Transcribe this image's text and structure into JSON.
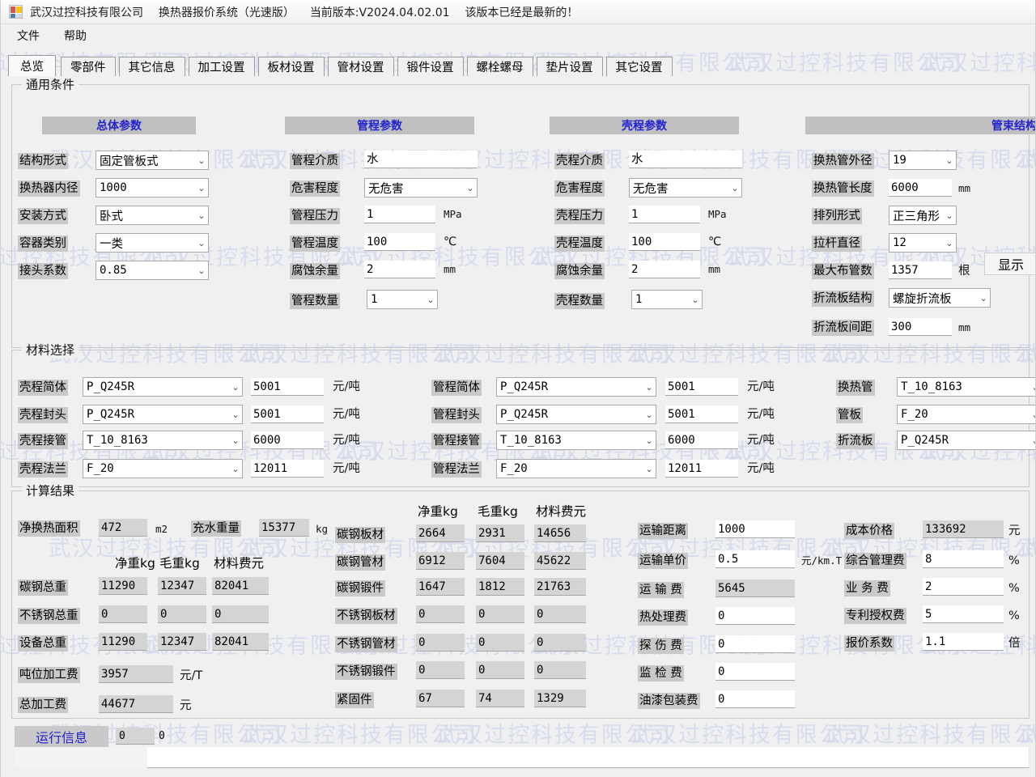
{
  "window": {
    "icon": "app-icon",
    "company": "武汉过控科技有限公司",
    "product": "换热器报价系统（光速版）",
    "version_label": "当前版本:V2024.04.02.01",
    "update_note": "该版本已经是最新的！"
  },
  "menu": [
    {
      "label": "文件"
    },
    {
      "label": "帮助"
    }
  ],
  "tabs": [
    {
      "label": "总览",
      "active": true
    },
    {
      "label": "零部件",
      "active": false
    },
    {
      "label": "其它信息",
      "active": false
    },
    {
      "label": "加工设置",
      "active": false
    },
    {
      "label": "板材设置",
      "active": false
    },
    {
      "label": "管材设置",
      "active": false
    },
    {
      "label": "锻件设置",
      "active": false
    },
    {
      "label": "螺栓螺母",
      "active": false
    },
    {
      "label": "垫片设置",
      "active": false
    },
    {
      "label": "其它设置",
      "active": false
    }
  ],
  "watermark": {
    "text": "武汉过控科技有限公司",
    "color": "#d7dced"
  },
  "general": {
    "title": "通用条件",
    "overall": {
      "header": "总体参数",
      "fields": [
        {
          "label": "结构形式",
          "value": "固定管板式",
          "type": "combo"
        },
        {
          "label": "换热器内径",
          "value": "1000",
          "type": "combo"
        },
        {
          "label": "安装方式",
          "value": "卧式",
          "type": "combo"
        },
        {
          "label": "容器类别",
          "value": "一类",
          "type": "combo"
        },
        {
          "label": "接头系数",
          "value": "0.85",
          "type": "combo"
        }
      ]
    },
    "tube_side": {
      "header": "管程参数",
      "fields": [
        {
          "label": "管程介质",
          "value": "水",
          "type": "text",
          "unit": ""
        },
        {
          "label": "危害程度",
          "value": "无危害",
          "type": "combo",
          "unit": ""
        },
        {
          "label": "管程压力",
          "value": "1",
          "type": "text",
          "unit": "MPa"
        },
        {
          "label": "管程温度",
          "value": "100",
          "type": "text",
          "unit": "℃"
        },
        {
          "label": "腐蚀余量",
          "value": "2",
          "type": "text",
          "unit": "mm"
        },
        {
          "label": "管程数量",
          "value": "1",
          "type": "combo",
          "unit": ""
        }
      ]
    },
    "shell_side": {
      "header": "壳程参数",
      "fields": [
        {
          "label": "壳程介质",
          "value": "水",
          "type": "text",
          "unit": ""
        },
        {
          "label": "危害程度",
          "value": "无危害",
          "type": "combo",
          "unit": ""
        },
        {
          "label": "壳程压力",
          "value": "1",
          "type": "text",
          "unit": "MPa"
        },
        {
          "label": "壳程温度",
          "value": "100",
          "type": "text",
          "unit": "℃"
        },
        {
          "label": "腐蚀余量",
          "value": "2",
          "type": "text",
          "unit": "mm"
        },
        {
          "label": "壳程数量",
          "value": "1",
          "type": "combo",
          "unit": ""
        }
      ]
    },
    "bundle": {
      "header": "管束结构",
      "display_button": "显示",
      "fields": [
        {
          "label": "换热管外径",
          "value": "19",
          "type": "combo",
          "unit": ""
        },
        {
          "label": "换热管长度",
          "value": "6000",
          "type": "text",
          "unit": "mm"
        },
        {
          "label": "排列形式",
          "value": "正三角形",
          "type": "combo",
          "unit": ""
        },
        {
          "label": "拉杆直径",
          "value": "12",
          "type": "combo",
          "unit": ""
        },
        {
          "label": "最大布管数",
          "value": "1357",
          "type": "text",
          "unit": "根"
        },
        {
          "label": "折流板结构",
          "value": "螺旋折流板",
          "type": "combo",
          "unit": ""
        },
        {
          "label": "折流板间距",
          "value": "300",
          "type": "text",
          "unit": "mm"
        }
      ]
    }
  },
  "materials": {
    "title": "材料选择",
    "unit": "元/吨",
    "shell": [
      {
        "label": "壳程简体",
        "material": "P_Q245R",
        "price": "5001"
      },
      {
        "label": "壳程封头",
        "material": "P_Q245R",
        "price": "5001"
      },
      {
        "label": "壳程接管",
        "material": "T_10_8163",
        "price": "6000"
      },
      {
        "label": "壳程法兰",
        "material": "F_20",
        "price": "12011"
      }
    ],
    "tube": [
      {
        "label": "管程简体",
        "material": "P_Q245R",
        "price": "5001"
      },
      {
        "label": "管程封头",
        "material": "P_Q245R",
        "price": "5001"
      },
      {
        "label": "管程接管",
        "material": "T_10_8163",
        "price": "6000"
      },
      {
        "label": "管程法兰",
        "material": "F_20",
        "price": "12011"
      }
    ],
    "bundle": [
      {
        "label": "换热管",
        "material": "T_10_8163"
      },
      {
        "label": "管板",
        "material": "F_20"
      },
      {
        "label": "折流板",
        "material": "P_Q245R"
      }
    ]
  },
  "results": {
    "title": "计算结果",
    "top": [
      {
        "label": "净换热面积",
        "value": "472",
        "unit": "m2"
      },
      {
        "label": "充水重量",
        "value": "15377",
        "unit": "kg"
      }
    ],
    "col_headers": [
      "净重kg",
      "毛重kg",
      "材料费元"
    ],
    "left_rows": [
      {
        "label": "碳钢总重",
        "net": "11290",
        "gross": "12347",
        "cost": "82041"
      },
      {
        "label": "不锈钢总重",
        "net": "0",
        "gross": "0",
        "cost": "0"
      },
      {
        "label": "设备总重",
        "net": "11290",
        "gross": "12347",
        "cost": "82041"
      }
    ],
    "left_extra": [
      {
        "label": "吨位加工费",
        "value": "3957",
        "unit": "元/T"
      },
      {
        "label": "总加工费",
        "value": "44677",
        "unit": "元"
      }
    ],
    "mid_rows": [
      {
        "label": "碳钢板材",
        "net": "2664",
        "gross": "2931",
        "cost": "14656"
      },
      {
        "label": "碳钢管材",
        "net": "6912",
        "gross": "7604",
        "cost": "45622"
      },
      {
        "label": "碳钢锻件",
        "net": "1647",
        "gross": "1812",
        "cost": "21763"
      },
      {
        "label": "不锈钢板材",
        "net": "0",
        "gross": "0",
        "cost": "0"
      },
      {
        "label": "不锈钢管材",
        "net": "0",
        "gross": "0",
        "cost": "0"
      },
      {
        "label": "不锈钢锻件",
        "net": "0",
        "gross": "0",
        "cost": "0"
      },
      {
        "label": "紧固件",
        "net": "67",
        "gross": "74",
        "cost": "1329"
      }
    ],
    "fees": [
      {
        "label": "运输距离",
        "value": "1000",
        "unit": "",
        "readonly": false
      },
      {
        "label": "运输单价",
        "value": "0.5",
        "unit": "元/km.T",
        "readonly": false
      },
      {
        "label": "运 输 费",
        "value": "5645",
        "unit": "",
        "readonly": true
      },
      {
        "label": "热处理费",
        "value": "0",
        "unit": "",
        "readonly": false
      },
      {
        "label": "探 伤 费",
        "value": "0",
        "unit": "",
        "readonly": false
      },
      {
        "label": "监 检 费",
        "value": "0",
        "unit": "",
        "readonly": false
      },
      {
        "label": "油漆包装费",
        "value": "0",
        "unit": "",
        "readonly": false
      }
    ],
    "pricing": [
      {
        "label": "成本价格",
        "value": "133692",
        "unit": "元",
        "readonly": true
      },
      {
        "label": "综合管理费",
        "value": "8",
        "unit": "%",
        "readonly": false
      },
      {
        "label": "业 务 费",
        "value": "2",
        "unit": "%",
        "readonly": false
      },
      {
        "label": "专利授权费",
        "value": "5",
        "unit": "%",
        "readonly": false
      },
      {
        "label": "报价系数",
        "value": "1.1",
        "unit": "倍",
        "readonly": false
      }
    ]
  },
  "statusbar": {
    "label": "运行信息",
    "value1": "0",
    "value2": "0",
    "message": ""
  }
}
